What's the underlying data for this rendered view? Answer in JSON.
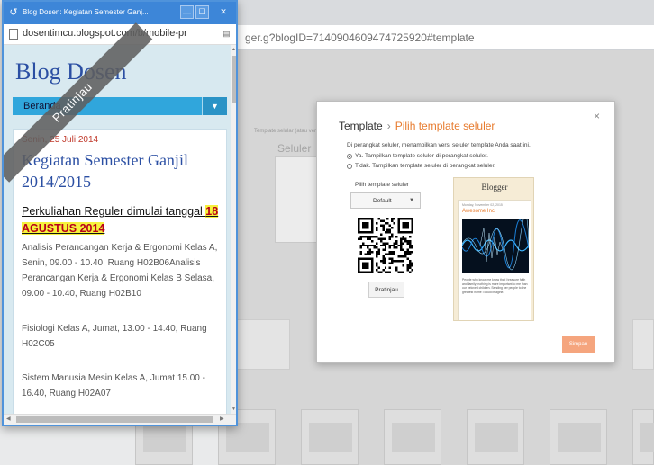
{
  "background_window": {
    "url_fragment": "ger.g?blogID=7140904609474725920#template",
    "faint_text": "Template selular (atau versi template biasa)",
    "seluler_label": "Seluler"
  },
  "dialog": {
    "close_label": "×",
    "breadcrumb_root": "Template",
    "breadcrumb_sep": "›",
    "breadcrumb_current": "Pilih template seluler",
    "description": "Di perangkat seluler, menampilkan versi seluler template Anda saat ini.",
    "options": [
      {
        "label": "Ya. Tampilkan template seluler di perangkat seluler.",
        "selected": true
      },
      {
        "label": "Tidak. Tampilkan template seluler di perangkat seluler.",
        "selected": false
      }
    ],
    "pick_label": "Pilih template seluler",
    "select_value": "Default",
    "preview_button": "Pratinjau",
    "save_button": "Simpan",
    "preview": {
      "blog_name": "Blogger",
      "date": "Monday, November 02, 2015",
      "post_title": "Awesome Inc.",
      "body_text": "People who know me know that I treasure faith and family; nothing is more important to me than our beloved children. Sending her people to the greatest home I could imagine."
    }
  },
  "popup": {
    "window_title": "Blog Dosen: Kegiatan Semester Ganj...",
    "min_label": "—",
    "max_label": "☐",
    "close_label": "✕",
    "url": "dosentimcu.blogspot.com/b/mobile-pr",
    "ribbon_text": "Pratinjau",
    "blog_title": "Blog Dosen",
    "nav_label": "Beranda",
    "post": {
      "date": "Senin, 25 Juli 2014",
      "title": "Kegiatan Semester Ganjil 2014/2015",
      "subtitle_plain": "Perkuliahan Reguler dimulai tanggal ",
      "subtitle_highlight": "18 AGUSTUS 2014",
      "paragraphs": [
        "Analisis Perancangan Kerja & Ergonomi Kelas A, Senin, 09.00 - 10.40, Ruang H02B06Analisis Perancangan Kerja & Ergonomi Kelas B Selasa, 09.00 - 10.40, Ruang H02B10",
        "Fisiologi Kelas A, Jumat, 13.00 - 14.40, Ruang H02C05",
        "Sistem Manusia Mesin Kelas A, Jumat 15.00 - 16.40, Ruang H02A07"
      ]
    }
  },
  "colors": {
    "titlebar": "#3d86d8",
    "blog_title": "#2b4fa3",
    "navbar": "#30a6dc",
    "highlight": "#f6f13c",
    "accent_orange": "#e77b2e"
  }
}
